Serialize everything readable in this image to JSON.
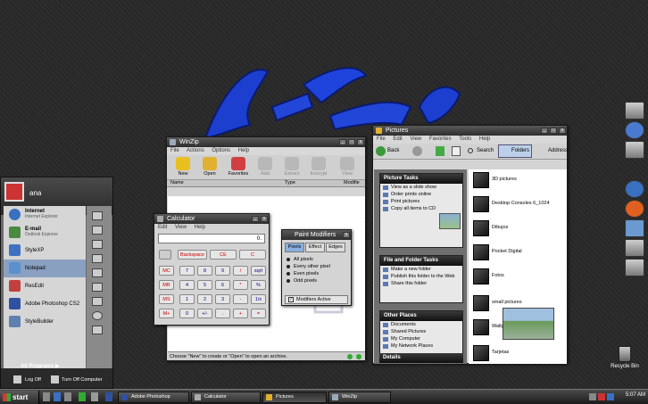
{
  "start_menu": {
    "username": "ana",
    "items": [
      {
        "title": "Internet",
        "subtitle": "Internet Explorer",
        "icon": "internet-explorer-icon"
      },
      {
        "title": "E-mail",
        "subtitle": "Outlook Express",
        "icon": "outlook-icon"
      },
      {
        "title": "StyleXP",
        "subtitle": "",
        "icon": "stylexp-icon"
      },
      {
        "title": "Notepad",
        "subtitle": "",
        "icon": "notepad-icon"
      },
      {
        "title": "ResEdit",
        "subtitle": "",
        "icon": "resedit-icon"
      },
      {
        "title": "Adobe Photoshop CS2",
        "subtitle": "",
        "icon": "photoshop-icon"
      },
      {
        "title": "StyleBuilder",
        "subtitle": "",
        "icon": "stylebuilder-icon"
      }
    ],
    "all_programs": "All Programs",
    "log_off": "Log Off",
    "turn_off": "Turn Off Computer"
  },
  "taskbar": {
    "start": "start",
    "items": [
      "Adobe Photoshop",
      "Calculator",
      "Pictures",
      "WinZip"
    ],
    "clock": "5:07 AM"
  },
  "winzip": {
    "title": "WinZip",
    "menu": [
      "File",
      "Actions",
      "Options",
      "Help"
    ],
    "tools": [
      "New",
      "Open",
      "Favorites",
      "Add",
      "Extract",
      "Encrypt",
      "View"
    ],
    "columns": [
      "Name",
      "Type",
      "Modifie"
    ],
    "status": "Choose \"New\" to create or \"Open\" to open an archive."
  },
  "calculator": {
    "title": "Calculator",
    "menu": [
      "Edit",
      "View",
      "Help"
    ],
    "display": "0.",
    "top_row": [
      "Backspace",
      "CE",
      "C"
    ],
    "memory": [
      "MC",
      "MR",
      "MS",
      "M+"
    ],
    "rows": [
      [
        "7",
        "8",
        "9",
        "/",
        "sqrt"
      ],
      [
        "4",
        "5",
        "6",
        "*",
        "%"
      ],
      [
        "1",
        "2",
        "3",
        "-",
        "1/x"
      ],
      [
        "0",
        "+/-",
        ".",
        "+",
        "="
      ]
    ]
  },
  "paint_modifiers": {
    "title": "Paint Modifiers",
    "tabs": [
      "Pixels",
      "Effect",
      "Edges"
    ],
    "options": [
      "All pixels",
      "Every other pixel",
      "Even pixels",
      "Odd pixels"
    ],
    "checkbox": "Modifiers Active"
  },
  "pictures": {
    "title": "Pictures",
    "menu": [
      "File",
      "Edit",
      "View",
      "Favorites",
      "Tools",
      "Help"
    ],
    "toolbar": {
      "back": "Back",
      "search": "Search",
      "folders": "Folders",
      "address": "Address"
    },
    "picture_tasks": {
      "header": "Picture Tasks",
      "links": [
        "View as a slide show",
        "Order prints online",
        "Print pictures",
        "Copy all items to CD"
      ]
    },
    "file_folder_tasks": {
      "header": "File and Folder Tasks",
      "links": [
        "Make a new folder",
        "Publish this folder to the Web",
        "Share this folder"
      ]
    },
    "other_places": {
      "header": "Other Places",
      "links": [
        "Documents",
        "Shared Pictures",
        "My Computer",
        "My Network Places"
      ]
    },
    "details": "Details",
    "files": [
      "3D pictures",
      "Desktop Consoles 6_1024",
      "Dibujos",
      "Pocket Digital",
      "Fotos",
      "small pictures",
      "Wallpapers",
      "Tarjetas"
    ]
  },
  "desktop": {
    "recycle_bin": "Recycle Bin"
  },
  "colors": {
    "accent": "#8ab0e0",
    "titlebar": "#2e2e2e",
    "desktop": "#2b2b2b"
  }
}
